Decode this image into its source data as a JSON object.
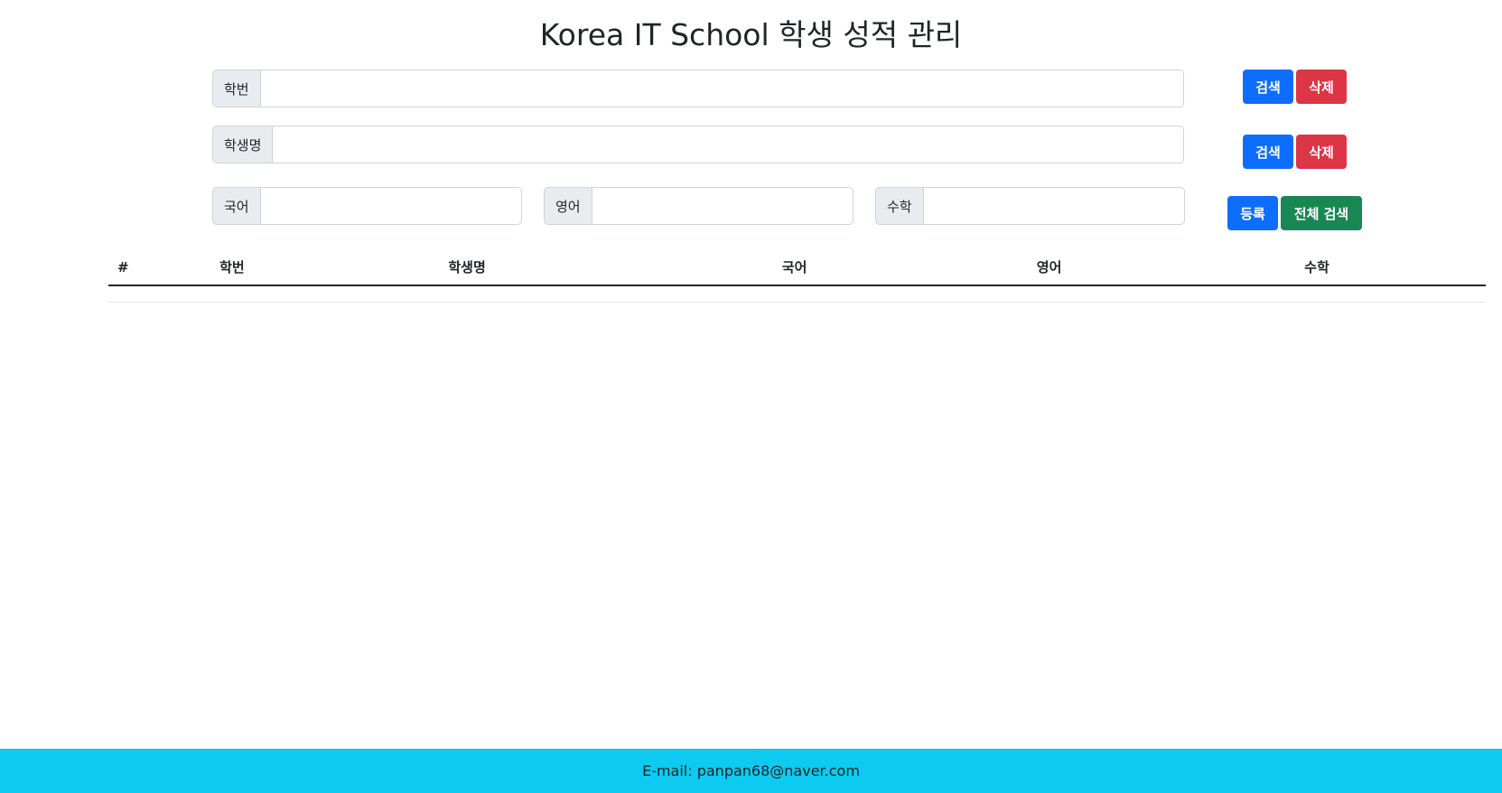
{
  "title": "Korea IT School 학생 성적 관리",
  "form": {
    "student_id": {
      "label": "학번",
      "value": ""
    },
    "student_name": {
      "label": "학생명",
      "value": ""
    },
    "korean": {
      "label": "국어",
      "value": ""
    },
    "english": {
      "label": "영어",
      "value": ""
    },
    "math": {
      "label": "수학",
      "value": ""
    }
  },
  "buttons": {
    "search": "검색",
    "delete": "삭제",
    "register": "등록",
    "search_all": "전체 검색"
  },
  "table": {
    "headers": [
      "#",
      "학번",
      "학생명",
      "국어",
      "영어",
      "수학"
    ],
    "rows": []
  },
  "footer": {
    "email_text": "E-mail: panpan68@naver.com"
  },
  "colors": {
    "primary": "#0d6efd",
    "danger": "#dc3545",
    "success": "#198754",
    "footer_bg": "#0dcaf0"
  }
}
